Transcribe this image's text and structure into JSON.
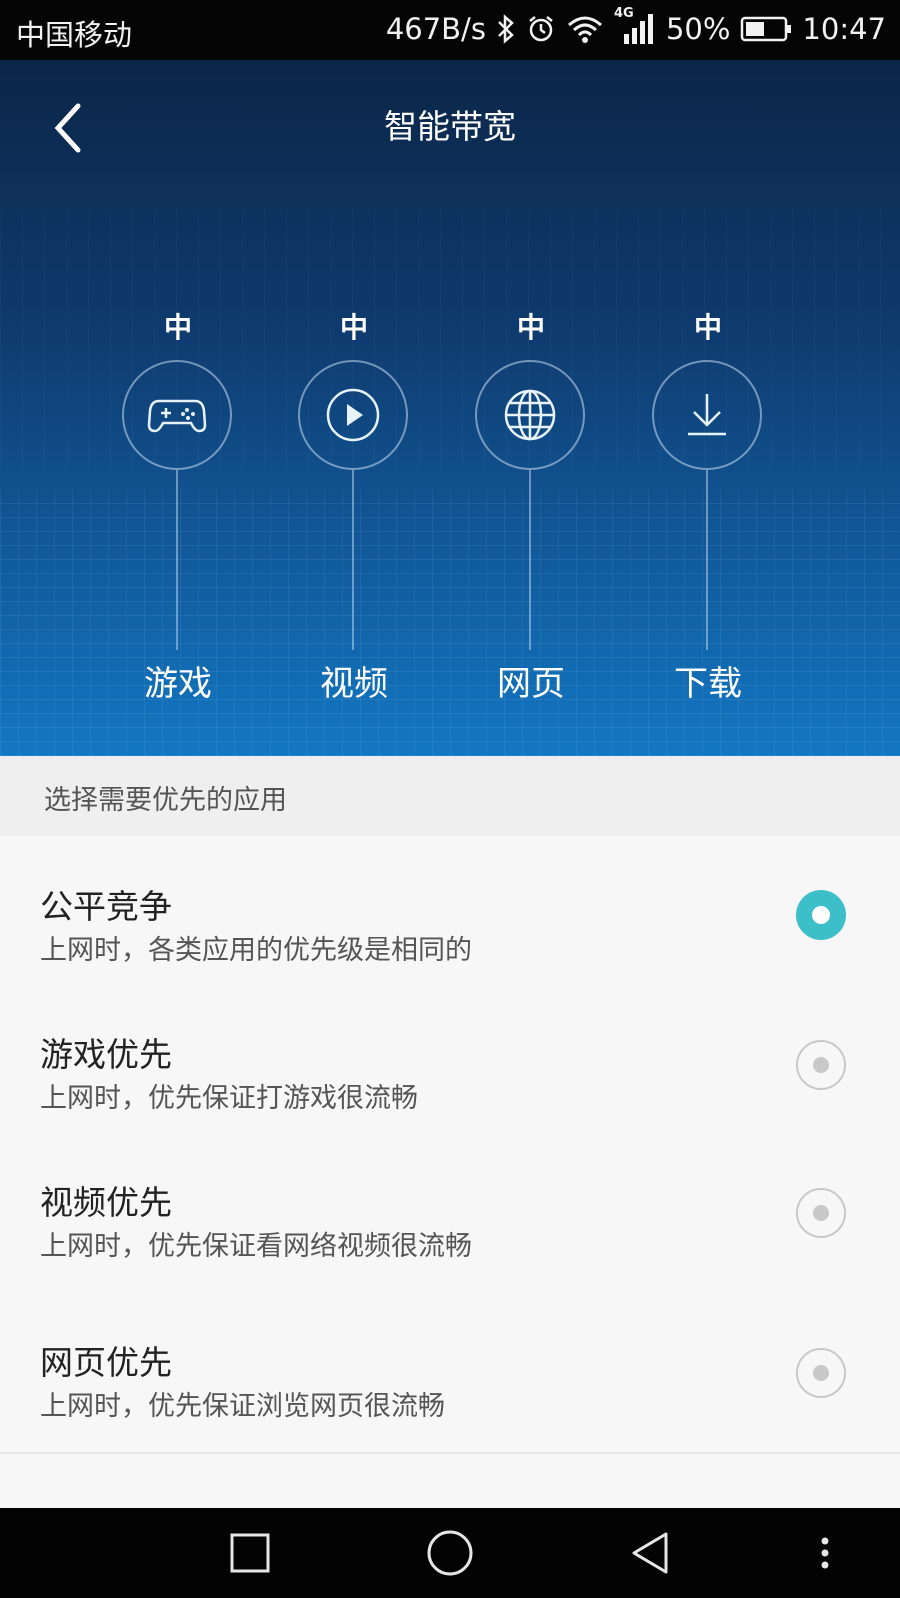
{
  "status_bar": {
    "carrier": "中国移动",
    "speed": "467B/s",
    "network": "4G",
    "battery": "50%",
    "time": "10:47"
  },
  "header": {
    "title": "智能带宽"
  },
  "categories": [
    {
      "level": "中",
      "name": "游戏",
      "icon": "gamepad-icon"
    },
    {
      "level": "中",
      "name": "视频",
      "icon": "play-icon"
    },
    {
      "level": "中",
      "name": "网页",
      "icon": "globe-icon"
    },
    {
      "level": "中",
      "name": "下载",
      "icon": "download-icon"
    }
  ],
  "section": {
    "label": "选择需要优先的应用"
  },
  "options": [
    {
      "title": "公平竞争",
      "desc": "上网时，各类应用的优先级是相同的",
      "selected": true
    },
    {
      "title": "游戏优先",
      "desc": "上网时，优先保证打游戏很流畅",
      "selected": false
    },
    {
      "title": "视频优先",
      "desc": "上网时，优先保证看网络视频很流畅",
      "selected": false
    },
    {
      "title": "网页优先",
      "desc": "上网时，优先保证浏览网页很流畅",
      "selected": false
    }
  ],
  "colors": {
    "accent": "#3cbfc8",
    "hero_top": "#0c2648",
    "hero_bottom": "#1377c2"
  },
  "nav_bar": {
    "icons": [
      "square-icon",
      "circle-home-icon",
      "triangle-back-icon",
      "more-vert-icon"
    ]
  }
}
